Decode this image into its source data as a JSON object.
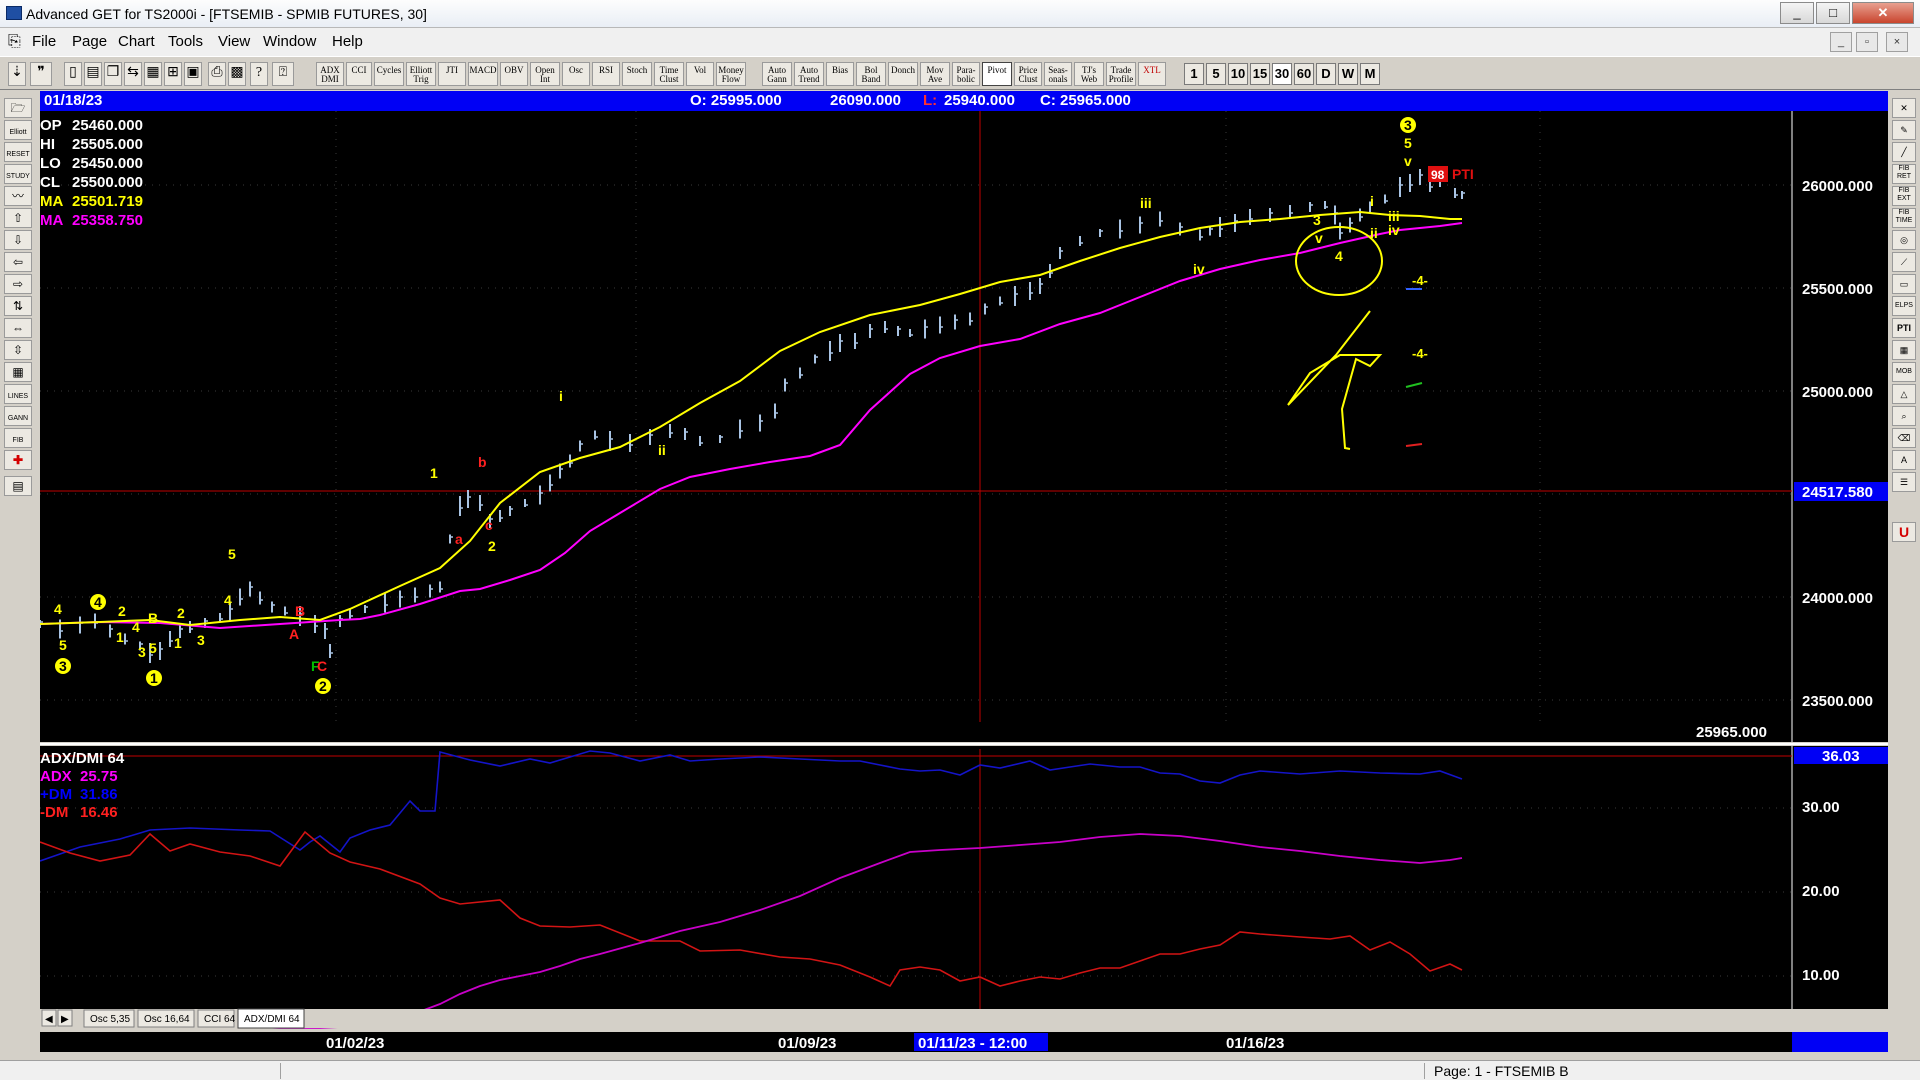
{
  "window": {
    "title": "Advanced GET for TS2000i - [FTSEMIB - SPMIB FUTURES, 30]",
    "minimize": "_",
    "maximize": "□",
    "close": "✕"
  },
  "menu": {
    "items": [
      "File",
      "Page",
      "Chart",
      "Tools",
      "View",
      "Window",
      "Help"
    ],
    "mdi": [
      "_",
      "▫",
      "×"
    ]
  },
  "toolbar": {
    "studies": [
      "ADX DMI",
      "CCI",
      "Cycles",
      "Elliott Trig",
      "JTI",
      "MACD",
      "OBV",
      "Open Int",
      "Osc",
      "RSI",
      "Stoch",
      "Time Clust",
      "Vol",
      "Money Flow",
      "Auto Gann",
      "Auto Trend",
      "Bias",
      "Bol Band",
      "Donch",
      "Mov Ave",
      "Para-bolic",
      "Pivot",
      "Price Clust",
      "Seas-onals",
      "TJ's Web",
      "Trade Profile",
      "XTL"
    ],
    "intervals": [
      "1",
      "5",
      "10",
      "15",
      "30",
      "60",
      "D",
      "W",
      "M"
    ],
    "selected_interval": "30"
  },
  "left_tools": [
    "Elliott",
    "STUDY",
    "RESET",
    "GANN",
    "LINES",
    "FIB"
  ],
  "right_tools": [
    "FIB RET",
    "FIB EXT",
    "FIB TIME",
    "ELPS",
    "PTI",
    "MOB",
    "U"
  ],
  "header": {
    "date": "01/18/23",
    "open": "O: 25995.000",
    "high": "26090.000",
    "low_label": "L:",
    "low_value": "25940.000",
    "close": "C: 25965.000"
  },
  "price_panel": {
    "readout": [
      {
        "label": "OP",
        "value": "25460.000",
        "color": "#ffffff"
      },
      {
        "label": "HI",
        "value": "25505.000",
        "color": "#ffffff"
      },
      {
        "label": "LO",
        "value": "25450.000",
        "color": "#ffffff"
      },
      {
        "label": "CL",
        "value": "25500.000",
        "color": "#ffffff"
      },
      {
        "label": "MA",
        "value": "25501.719",
        "color": "#ffff00"
      },
      {
        "label": "MA",
        "value": "25358.750",
        "color": "#ff00ff"
      }
    ],
    "y_ticks": [
      "26000.000",
      "25500.000",
      "25000.000",
      "24000.000",
      "23500.000"
    ],
    "cursor_price": "24517.580",
    "last_close": "25965.000",
    "pti_value": "98",
    "pti_label": "PTI",
    "projection_labels": [
      "-4-",
      "-4-"
    ]
  },
  "indicator_panel": {
    "title": "ADX/DMI 64",
    "readout": [
      {
        "label": "ADX",
        "value": "25.75",
        "color": "#ff00ff"
      },
      {
        "label": "+DM",
        "value": "31.86",
        "color": "#0000ff"
      },
      {
        "label": "-DM",
        "value": "16.46",
        "color": "#ff2020"
      }
    ],
    "y_ticks": [
      "30.00",
      "20.00",
      "10.00"
    ],
    "current_value": "36.03",
    "tabs": [
      "Osc 5,35",
      "Osc 16,64",
      "CCI 64",
      "ADX/DMI 64"
    ],
    "active_tab": "ADX/DMI 64"
  },
  "time_axis": {
    "labels": [
      "01/02/23",
      "01/09/23",
      "01/11/23 - 12:00",
      "01/16/23"
    ]
  },
  "elliott_labels": [
    {
      "text": "4",
      "color": "#ffff00"
    },
    {
      "text": "5",
      "color": "#ffff00"
    },
    {
      "text": "3",
      "color": "#ffff00"
    },
    {
      "text": "4",
      "color": "#ffff00"
    },
    {
      "text": "2",
      "color": "#ffff00"
    },
    {
      "text": "1",
      "color": "#ffff00"
    },
    {
      "text": "4",
      "color": "#ffff00"
    },
    {
      "text": "3",
      "color": "#ffff00"
    },
    {
      "text": "B",
      "color": "#ffff00"
    },
    {
      "text": "5",
      "color": "#ffff00"
    },
    {
      "text": "1",
      "color": "#ffff00"
    },
    {
      "text": "2",
      "color": "#ffff00"
    },
    {
      "text": "1",
      "color": "#ffff00"
    },
    {
      "text": "3",
      "color": "#ffff00"
    },
    {
      "text": "5",
      "color": "#ffff00"
    },
    {
      "text": "4",
      "color": "#ffff00"
    },
    {
      "text": "B",
      "color": "#ff2020"
    },
    {
      "text": "A",
      "color": "#ff2020"
    },
    {
      "text": "F",
      "color": "#00c000"
    },
    {
      "text": "C",
      "color": "#ff2020"
    },
    {
      "text": "2",
      "color": "#ffff00"
    },
    {
      "text": "1",
      "color": "#ffff00"
    },
    {
      "text": "a",
      "color": "#ff2020"
    },
    {
      "text": "b",
      "color": "#ff2020"
    },
    {
      "text": "c",
      "color": "#ff2020"
    },
    {
      "text": "2",
      "color": "#ffff00"
    },
    {
      "text": "i",
      "color": "#ffff00"
    },
    {
      "text": "ii",
      "color": "#ffff00"
    },
    {
      "text": "iii",
      "color": "#ffff00"
    },
    {
      "text": "iv",
      "color": "#ffff00"
    },
    {
      "text": "3",
      "color": "#ffff00"
    },
    {
      "text": "v",
      "color": "#ffff00"
    },
    {
      "text": "4",
      "color": "#ffff00"
    },
    {
      "text": "i",
      "color": "#ffff00"
    },
    {
      "text": "ii",
      "color": "#ffff00"
    },
    {
      "text": "iii",
      "color": "#ffff00"
    },
    {
      "text": "iv",
      "color": "#ffff00"
    },
    {
      "text": "3",
      "color": "#ffff00"
    },
    {
      "text": "5",
      "color": "#ffff00"
    },
    {
      "text": "v",
      "color": "#ffff00"
    }
  ],
  "status": {
    "text": "Page: 1 - FTSEMIB B"
  },
  "colors": {
    "bars": "#a9c4e4",
    "ma_fast": "#ffff00",
    "ma_slow": "#ff00ff",
    "plus_dm": "#1414c8",
    "minus_dm": "#d21414",
    "adx": "#c800c8",
    "header_bg": "#0000f5"
  }
}
